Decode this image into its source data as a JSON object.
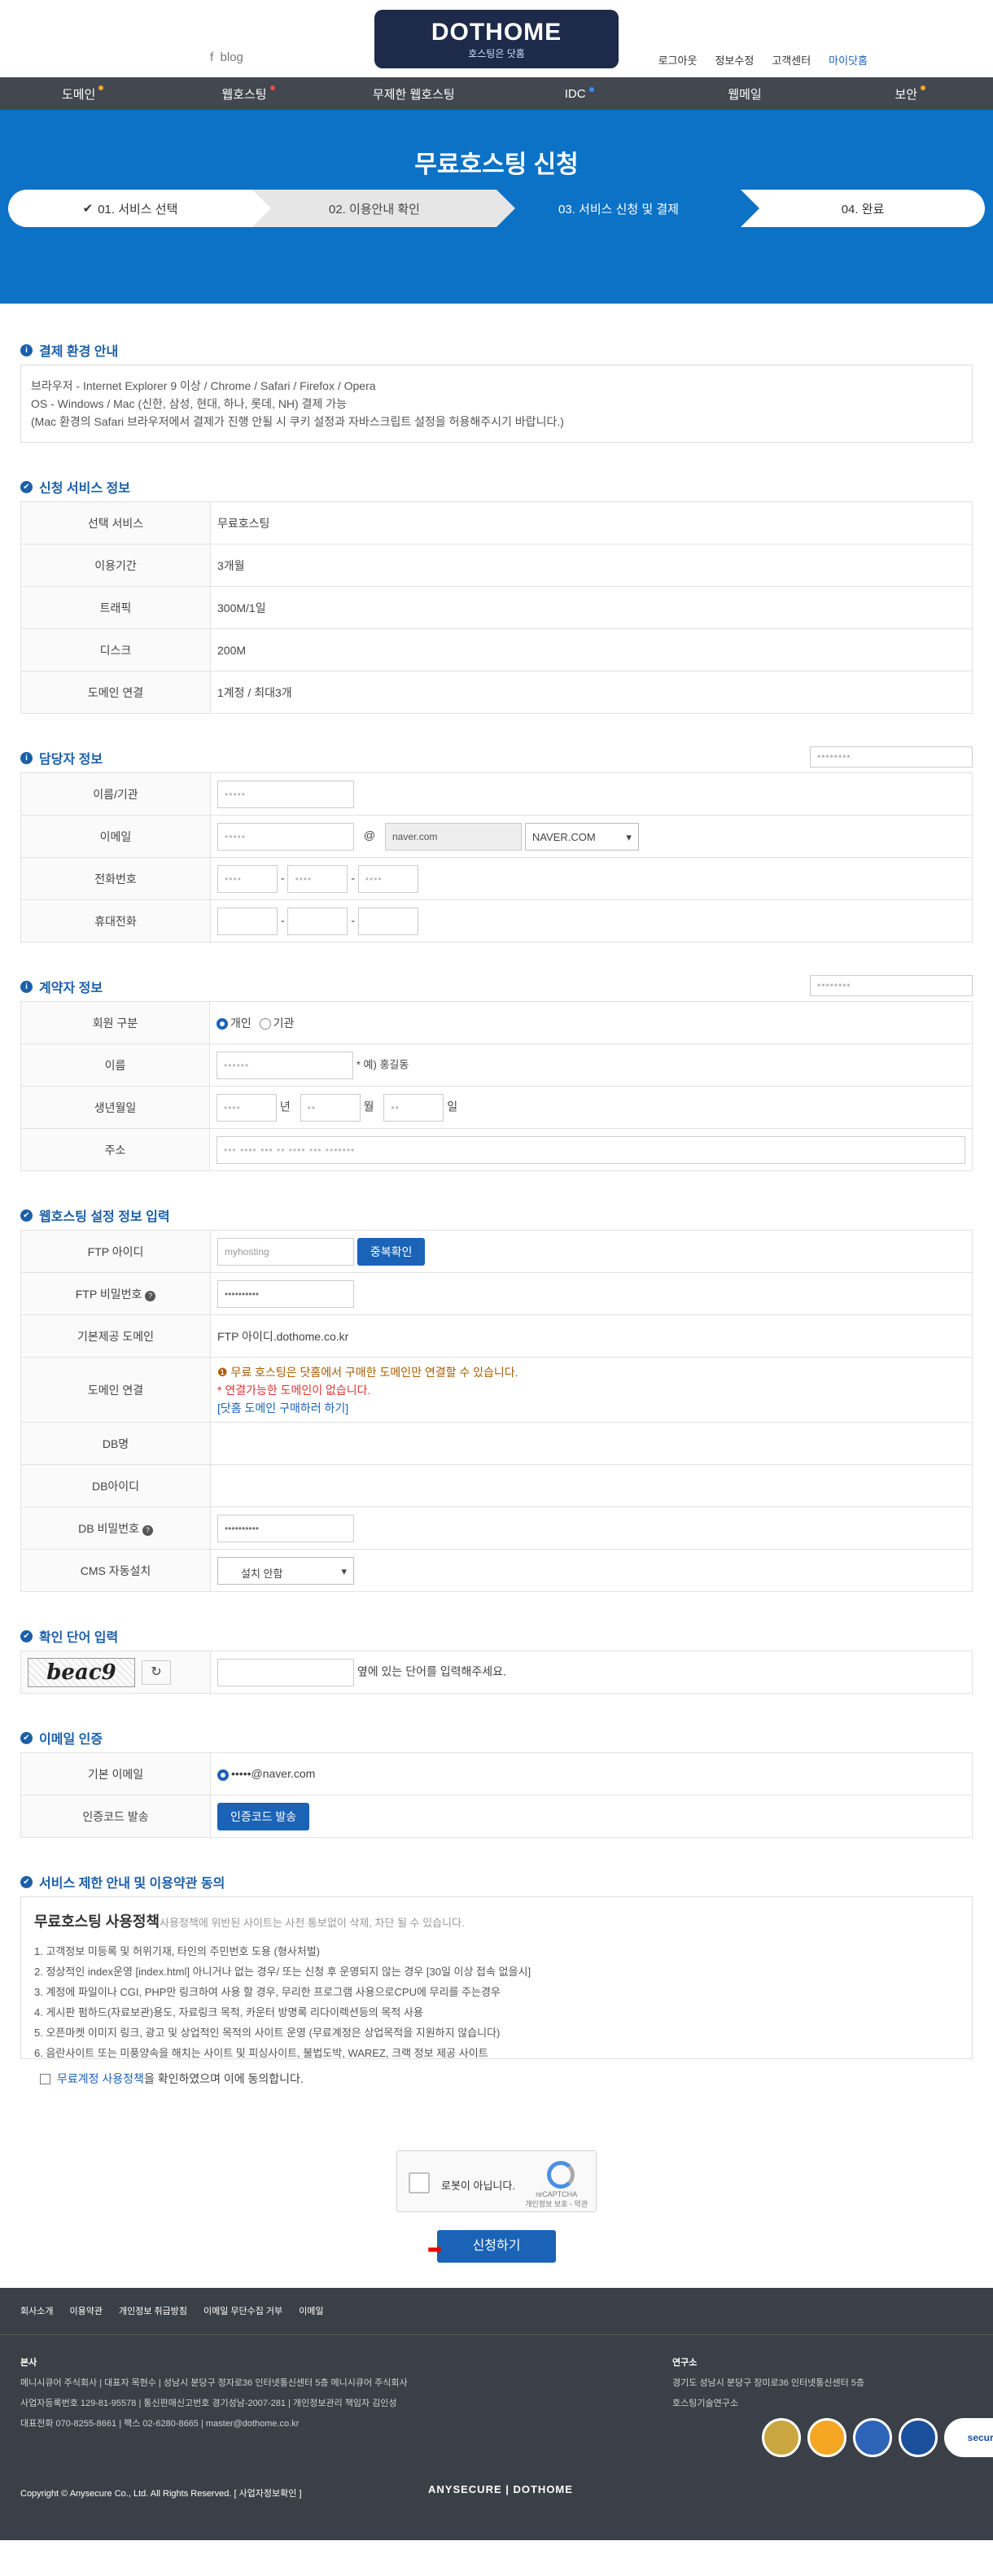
{
  "header": {
    "blog": "blog",
    "logo_main": "DOTHOME",
    "logo_sub": "호스팅은 닷홈",
    "links": [
      "로그아웃",
      "정보수정",
      "고객센터",
      "마이닷홈"
    ]
  },
  "nav": [
    {
      "label": "도메인",
      "dot": "#f5a623"
    },
    {
      "label": "웹호스팅",
      "dot": "#e94b4b"
    },
    {
      "label": "무제한 웹호스팅",
      "dot": ""
    },
    {
      "label": "IDC",
      "dot": "#3b8cff"
    },
    {
      "label": "웹메일",
      "dot": ""
    },
    {
      "label": "보안",
      "dot": "#f5a623"
    }
  ],
  "hero": {
    "title": "무료호스팅 신청",
    "steps": [
      "01. 서비스 선택",
      "02. 이용안내 확인",
      "03. 서비스 신청 및 결제",
      "04. 완료"
    ]
  },
  "payment_env": {
    "title": "결제 환경 안내",
    "lines": [
      "브라우저 - Internet Explorer 9 이상 / Chrome / Safari / Firefox / Opera",
      "OS - Windows / Mac (신한, 삼성, 현대, 하나, 롯데, NH) 결제 가능",
      "(Mac 환경의 Safari 브라우저에서 결제가 진행 안될 시 쿠키 설정과 자바스크립트 설정을 허용해주시기 바랍니다.)"
    ]
  },
  "service_info": {
    "title": "신청 서비스 정보",
    "rows": [
      {
        "k": "선택 서비스",
        "v": "무료호스팅"
      },
      {
        "k": "이용기간",
        "v": "3개월"
      },
      {
        "k": "트래픽",
        "v": "300M/1일"
      },
      {
        "k": "디스크",
        "v": "200M"
      },
      {
        "k": "도메인 연결",
        "v": "1계정 / 최대3개"
      }
    ]
  },
  "manager": {
    "title": "담당자 정보",
    "select": "••••••••",
    "labels": [
      "이름/기관",
      "이메일",
      "전화번호",
      "휴대전화"
    ],
    "name_value": "•••••",
    "email_id": "•••••",
    "email_at": "@",
    "email_domain": "naver.com",
    "email_select": "NAVER.COM",
    "phone": [
      "••••",
      "••••",
      "••••"
    ],
    "dash": "-"
  },
  "contractor": {
    "title": "계약자 정보",
    "select": "••••••••",
    "labels": [
      "회원 구분",
      "이름",
      "생년월일",
      "주소"
    ],
    "type_personal": "개인",
    "type_org": "기관",
    "name_value": "••••••",
    "name_hint": "* 예) 홍길동",
    "birth": [
      "••••",
      "••",
      "••"
    ],
    "birth_units": [
      "년",
      "월",
      "일"
    ],
    "address": "••• •••• ••• •• •••• ••• •••••••"
  },
  "hosting": {
    "title": "웹호스팅 설정 정보 입력",
    "labels": [
      "FTP 아이디",
      "FTP 비밀번호",
      "기본제공 도메인",
      "도메인 연결",
      "DB명",
      "DB아이디",
      "DB 비밀번호",
      "CMS 자동설치"
    ],
    "ftp_placeholder": "myhosting",
    "dup_button": "중복확인",
    "password_mask": "••••••••••",
    "base_domain": "FTP 아이디.dothome.co.kr",
    "domain_notice": "무료 호스팅은 닷홈에서 구매한 도메인만 연결할 수 있습니다.",
    "domain_none": "* 연결가능한 도메인이 없습니다.",
    "domain_buy": "[닷홈 도메인 구매하러 하기]",
    "cms": "설치 안함"
  },
  "captcha": {
    "title": "확인 단어 입력",
    "image_text": "beac9",
    "refresh": "↻",
    "hint": "옆에 있는 단어를 입력해주세요."
  },
  "email_auth": {
    "title": "이메일 인증",
    "labels": [
      "기본 이메일",
      "인증코드 발송"
    ],
    "email": "•••••@naver.com",
    "send_button": "인증코드 발송"
  },
  "terms": {
    "title": "서비스 제한 안내 및 이용약관 동의",
    "heading": "무료호스팅 사용정책",
    "heading_sub": "사용정책에 위반된 사이트는 사전 통보없이 삭제, 차단 될 수 있습니다.",
    "items": [
      "1. 고객정보 미등록 및 허위기재, 타인의 주민번호 도용 (형사처벌)",
      "2. 정상적인 index운영 [index.html] 아니거나 없는 경우/ 또는 신청 후 운영되지 않는 경우 [30일 이상 접속 없을시]",
      "3. 계정에 파일이나 CGI, PHP만 링크하여 사용 할 경우, 무리한 프로그램 사용으로CPU에 무리를 주는경우",
      "4. 게시판 펌하드(자료보관)용도, 자료링크 목적, 카운터 방명록 리다이렉션등의 목적 사용",
      "5. 오픈마켓 이미지 링크, 광고 및 상업적인 목적의 사이트 운영 (무료계정은 상업목적을 지원하지 않습니다)",
      "6. 음란사이트 또는 미풍양속을 해치는 사이트 및 피싱사이트, 불법도박, WAREZ, 크랙 정보 제공 사이트"
    ],
    "agree_link": "무료계정 사용정책",
    "agree_text": "을 확인하였으며 이에 동의합니다."
  },
  "recaptcha": {
    "label": "로봇이 아닙니다.",
    "brand": "reCAPTCHA",
    "links": "개인정보 보호 - 약관"
  },
  "submit": "신청하기",
  "footer": {
    "nav": [
      "회사소개",
      "이용약관",
      "개인정보 취급방침",
      "이메일 무단수집 거부",
      "이메일"
    ],
    "left_title": "본사",
    "left_lines": [
      "메니시큐어 주식회사 | 대표자 목현수 | 성남시 분당구 정자로36 인터넷통신센터 5층 메니시큐어 주식회사",
      "사업자등록번호 129-81-95578 | 통신판매신고번호 경기성남-2007-281 | 개인정보관리 책임자 김인성",
      "대표전화 070-8255-8661 | 팩스 02-6280-8665 | master@dothome.co.kr"
    ],
    "right_title": "연구소",
    "right_lines": [
      "경기도 성남시 분당구 장미로36 인터넷통신센터 5층",
      "호스팅기술연구소"
    ],
    "badge_text": "secure",
    "copyright": "Copyright © Anysecure Co., Ltd. All Rights Reserved. [ 사업자정보확인 ]",
    "logo": "ANYSECURE | DOTHOME"
  }
}
